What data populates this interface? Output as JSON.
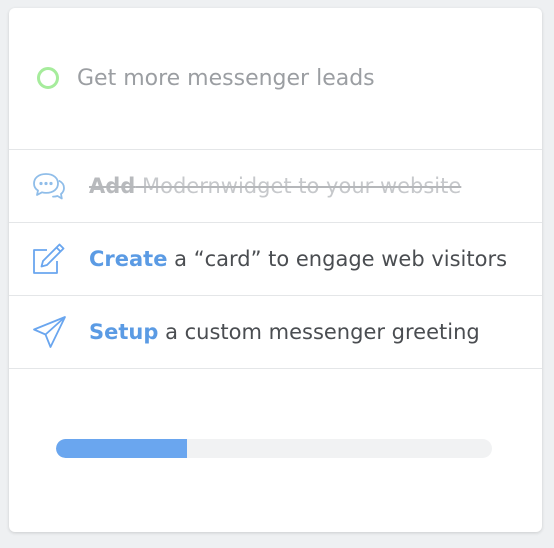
{
  "checklist": {
    "title": "Get more messenger leads",
    "status_color": "#a6ec9c",
    "accent_color": "#5b9be4",
    "tasks": [
      {
        "icon": "chat-bubbles-icon",
        "verb": "Add",
        "rest": " Modernwidget to your website",
        "completed": true
      },
      {
        "icon": "pencil-edit-icon",
        "verb": "Create",
        "rest": " a “card” to engage web visitors",
        "completed": false
      },
      {
        "icon": "paper-plane-icon",
        "verb": "Setup",
        "rest": " a custom messenger greeting",
        "completed": false
      }
    ],
    "progress": 0.3
  }
}
